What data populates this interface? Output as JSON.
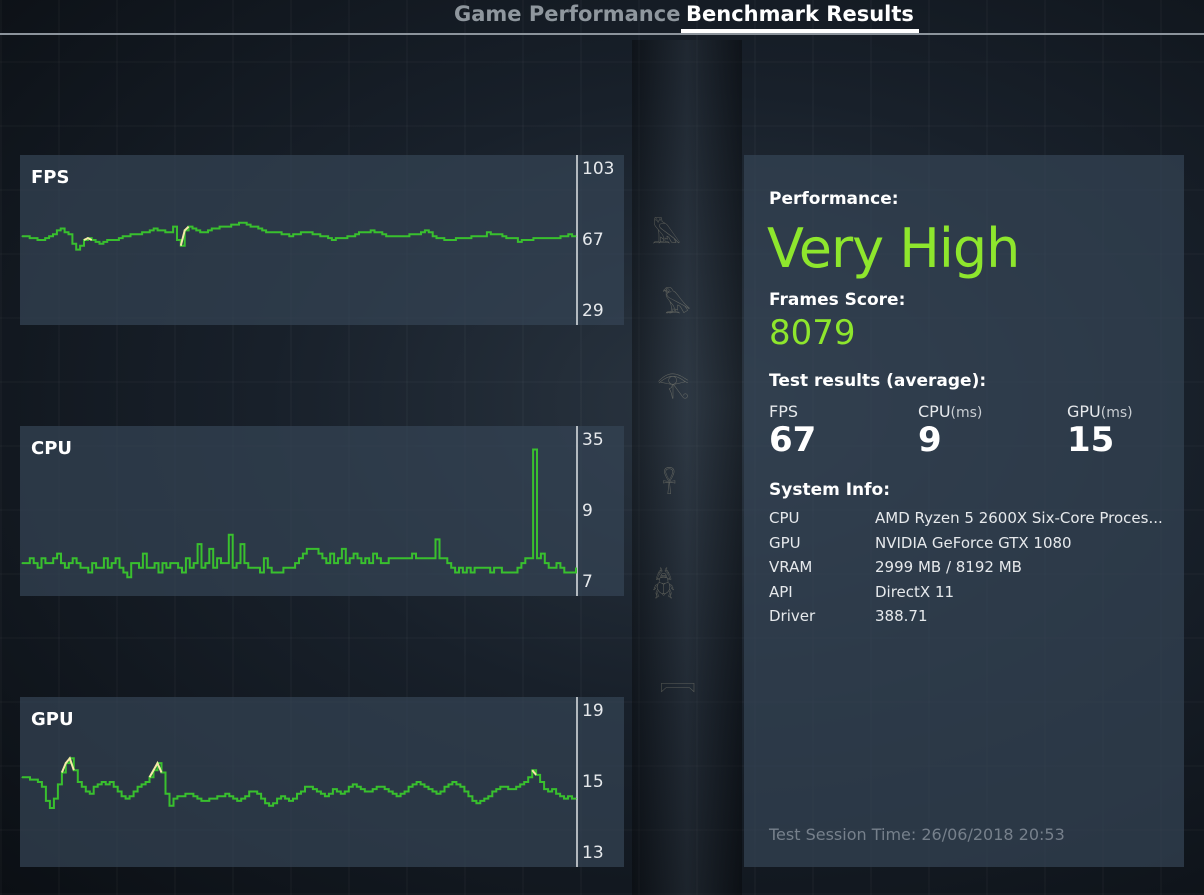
{
  "tabs": [
    {
      "label": "Game Performance"
    },
    {
      "label": "Benchmark Results"
    }
  ],
  "charts": {
    "fps": {
      "title": "FPS",
      "ticks": [
        "103",
        "67",
        "29"
      ]
    },
    "cpu": {
      "title": "CPU",
      "ticks": [
        "35",
        "9",
        "7"
      ]
    },
    "gpu": {
      "title": "GPU",
      "ticks": [
        "19",
        "15",
        "13"
      ]
    }
  },
  "colors": {
    "line": "#39c02e",
    "highlight": "#f4e9a8",
    "accent": "#8ee62d"
  },
  "chart_data": [
    {
      "type": "line",
      "title": "FPS",
      "yticks": [
        103,
        67,
        29
      ],
      "ylim": [
        29,
        103
      ],
      "values": [
        68,
        68,
        67,
        67,
        66,
        66,
        67,
        68,
        69,
        71,
        72,
        70,
        69,
        64,
        61,
        63,
        66,
        67,
        66,
        65,
        64,
        65,
        66,
        66,
        66,
        67,
        68,
        68,
        69,
        69,
        69,
        70,
        70,
        71,
        72,
        71,
        71,
        70,
        70,
        73,
        66,
        63,
        71,
        73,
        72,
        71,
        70,
        70,
        71,
        72,
        72,
        73,
        73,
        73,
        74,
        74,
        75,
        75,
        74,
        73,
        73,
        72,
        71,
        70,
        70,
        70,
        70,
        69,
        69,
        68,
        69,
        69,
        70,
        70,
        70,
        69,
        69,
        68,
        68,
        67,
        66,
        67,
        67,
        67,
        68,
        68,
        69,
        70,
        70,
        70,
        71,
        70,
        70,
        69,
        68,
        68,
        68,
        68,
        68,
        68,
        69,
        69,
        69,
        70,
        71,
        70,
        68,
        67,
        67,
        66,
        66,
        66,
        67,
        67,
        67,
        67,
        68,
        68,
        68,
        68,
        70,
        69,
        69,
        69,
        68,
        67,
        67,
        67,
        65,
        66,
        66,
        66,
        67,
        67,
        67,
        67,
        67,
        67,
        67,
        68,
        68,
        69,
        68,
        68
      ],
      "highlight_dips": [
        [
          17,
          61
        ],
        [
          42,
          63
        ]
      ]
    },
    {
      "type": "line",
      "title": "CPU",
      "yticks": [
        35,
        9,
        7
      ],
      "values": [
        9,
        9,
        10,
        9,
        8,
        10,
        9,
        9,
        10,
        11,
        9,
        8,
        9,
        10,
        9,
        8,
        8,
        7,
        9,
        8,
        8,
        10,
        8,
        9,
        10,
        8,
        7,
        6,
        9,
        9,
        8,
        11,
        8,
        8,
        9,
        7,
        9,
        8,
        9,
        9,
        8,
        7,
        10,
        8,
        9,
        13,
        8,
        9,
        12,
        8,
        10,
        9,
        9,
        15,
        8,
        9,
        13,
        9,
        8,
        8,
        8,
        7,
        10,
        8,
        7,
        7,
        7,
        8,
        8,
        8,
        9,
        10,
        11,
        12,
        12,
        12,
        11,
        10,
        9,
        11,
        9,
        10,
        12,
        9,
        10,
        11,
        10,
        9,
        10,
        9,
        11,
        10,
        9,
        9,
        10,
        10,
        10,
        10,
        10,
        10,
        11,
        10,
        10,
        10,
        10,
        10,
        14,
        10,
        10,
        9,
        8,
        7,
        8,
        7,
        8,
        7,
        8,
        8,
        8,
        8,
        7,
        8,
        8,
        7,
        7,
        7,
        7,
        8,
        9,
        10,
        10,
        33,
        10,
        11,
        9,
        8,
        8,
        9,
        8,
        7,
        7,
        7,
        8
      ],
      "ylim": [
        5,
        35
      ]
    },
    {
      "type": "line",
      "title": "GPU",
      "yticks": [
        19,
        15,
        13
      ],
      "ylim": [
        13,
        19
      ],
      "values": [
        16.2,
        16.2,
        16.1,
        16.1,
        16.0,
        15.8,
        15.2,
        14.9,
        15.3,
        15.9,
        16.4,
        16.8,
        17.0,
        16.5,
        16.0,
        15.8,
        15.6,
        15.5,
        15.8,
        15.9,
        16.0,
        15.9,
        16.0,
        15.8,
        15.6,
        15.4,
        15.3,
        15.4,
        15.6,
        15.8,
        15.9,
        16.0,
        16.2,
        16.5,
        16.8,
        16.4,
        15.5,
        15.0,
        15.3,
        15.4,
        15.4,
        15.5,
        15.5,
        15.4,
        15.3,
        15.2,
        15.2,
        15.3,
        15.3,
        15.4,
        15.4,
        15.5,
        15.4,
        15.3,
        15.2,
        15.3,
        15.4,
        15.6,
        15.6,
        15.5,
        15.3,
        15.1,
        15.0,
        15.1,
        15.3,
        15.4,
        15.3,
        15.2,
        15.3,
        15.5,
        15.6,
        15.8,
        15.8,
        15.7,
        15.6,
        15.5,
        15.4,
        15.5,
        15.7,
        15.6,
        15.5,
        15.6,
        15.8,
        15.9,
        15.8,
        15.7,
        15.6,
        15.6,
        15.7,
        15.8,
        15.8,
        15.7,
        15.6,
        15.5,
        15.4,
        15.5,
        15.6,
        15.8,
        15.9,
        16.0,
        15.9,
        15.8,
        15.7,
        15.6,
        15.5,
        15.6,
        15.8,
        15.9,
        16.0,
        15.9,
        15.8,
        15.6,
        15.4,
        15.2,
        15.1,
        15.2,
        15.3,
        15.4,
        15.6,
        15.7,
        15.8,
        15.8,
        15.7,
        15.7,
        15.8,
        15.9,
        16.0,
        16.2,
        16.5,
        16.3,
        16.0,
        15.7,
        15.6,
        15.7,
        15.5,
        15.4,
        15.3,
        15.4,
        15.3,
        15.3
      ],
      "highlight_ranges": [
        [
          2,
          2
        ],
        [
          10,
          13
        ],
        [
          32,
          35
        ],
        [
          128,
          129
        ]
      ]
    }
  ],
  "results": {
    "performance_label": "Performance:",
    "performance_value": "Very High",
    "frames_label": "Frames Score:",
    "frames_value": "8079",
    "test_results_label": "Test results (average):",
    "metrics": [
      {
        "label": "FPS",
        "unit": "",
        "value": "67"
      },
      {
        "label": "CPU",
        "unit": "(ms)",
        "value": "9"
      },
      {
        "label": "GPU",
        "unit": "(ms)",
        "value": "15"
      }
    ],
    "system_label": "System Info:",
    "system": [
      {
        "key": "CPU",
        "value": "AMD Ryzen 5 2600X Six-Core Proces..."
      },
      {
        "key": "GPU",
        "value": "NVIDIA GeForce GTX 1080"
      },
      {
        "key": "VRAM",
        "value": "2999 MB / 8192 MB"
      },
      {
        "key": "API",
        "value": "DirectX 11"
      },
      {
        "key": "Driver",
        "value": "388.71"
      }
    ],
    "session": "Test Session Time: 26/06/2018 20:53"
  }
}
